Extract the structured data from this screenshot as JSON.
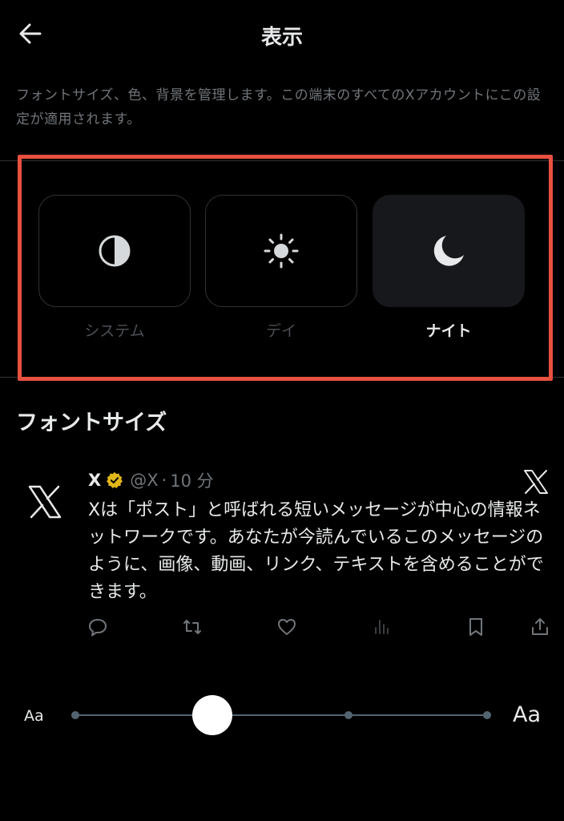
{
  "header": {
    "title": "表示",
    "back_icon": "arrow-left-icon"
  },
  "description": "フォントサイズ、色、背景を管理します。この端末のすべてのXアカウントにこの設定が適用されます。",
  "themes": [
    {
      "label": "システム",
      "icon": "half-circle-icon",
      "selected": false
    },
    {
      "label": "デイ",
      "icon": "sun-icon",
      "selected": false
    },
    {
      "label": "ナイト",
      "icon": "moon-icon",
      "selected": true
    }
  ],
  "font_size_section": {
    "title": "フォントサイズ"
  },
  "post": {
    "name": "X",
    "handle": "@X",
    "dot": "·",
    "time": "10 分",
    "text": "Xは「ポスト」と呼ばれる短いメッセージが中心の情報ネットワークです。あなたが今読んでいるこのメッセージのように、画像、動画、リンク、テキストを含めることができます。",
    "actions": [
      "reply-icon",
      "repost-icon",
      "like-icon",
      "views-icon",
      "bookmark-icon",
      "share-icon"
    ]
  },
  "slider": {
    "min_label": "Aa",
    "max_label": "Aa",
    "steps": 5,
    "selected_step": 1
  },
  "colors": {
    "accent_highlight": "#e8503f",
    "verified_gold": "#e2b719",
    "muted_text": "#71767b",
    "selected_card": "#16181c"
  }
}
